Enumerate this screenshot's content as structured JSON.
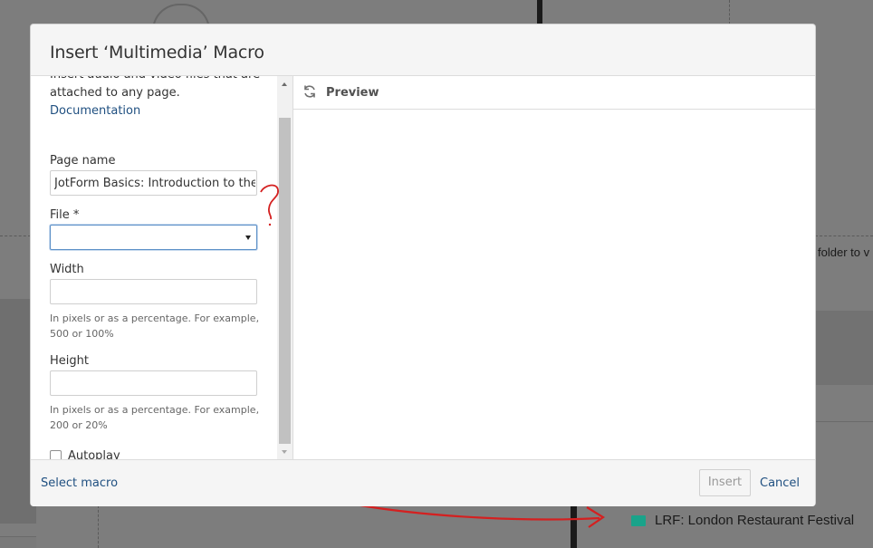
{
  "background": {
    "side_text": "folder to v",
    "list_item": "LRF: London Restaurant Festival"
  },
  "dialog": {
    "title": "Insert ‘Multimedia’ Macro",
    "description_lines": [
      "Insert audio and video files that are",
      "attached to any page."
    ],
    "documentation_link": "Documentation",
    "page_name": {
      "label": "Page name",
      "value": "JotForm Basics: Introduction to the"
    },
    "file": {
      "label": "File *",
      "value": ""
    },
    "width": {
      "label": "Width",
      "value": "",
      "hint_line1": "In pixels or as a percentage. For example,",
      "hint_line2": "500 or 100%"
    },
    "height": {
      "label": "Height",
      "value": "",
      "hint_line1": "In pixels or as a percentage. For example,",
      "hint_line2": "200 or 20%"
    },
    "autoplay": {
      "label": "Autoplay",
      "checked": false
    },
    "preview": {
      "label": "Preview"
    },
    "footer": {
      "select_macro": "Select macro",
      "insert": "Insert",
      "cancel": "Cancel"
    }
  },
  "colors": {
    "link": "#205081",
    "annotation": "#d42020",
    "folder_icon": "#1aa38a"
  },
  "icons": [
    "refresh-icon",
    "chevron-down-icon",
    "folder-icon"
  ]
}
